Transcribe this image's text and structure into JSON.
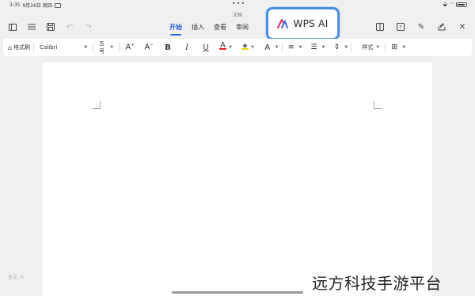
{
  "status_bar": {
    "time": "3:35",
    "date": "9月26日 周四",
    "document_label": "文档"
  },
  "nav": {
    "tabs": [
      {
        "label": "开始",
        "active": true
      },
      {
        "label": "插入",
        "active": false
      },
      {
        "label": "查看",
        "active": false
      },
      {
        "label": "审阅",
        "active": false
      }
    ],
    "wps_ai_label": "WPS AI"
  },
  "toolbar": {
    "format_painter": "格式刷",
    "font_name": "Calibri",
    "font_size": "五号",
    "style_label": "样式"
  },
  "footer": {
    "word_count": "全文: 0",
    "watermark": "远方科技手游平台"
  },
  "colors": {
    "accent": "#2b5fd9",
    "highlight_border": "#4a90e2",
    "font_color_bar": "#e02020",
    "highlight_color_bar": "#f5d90a"
  }
}
